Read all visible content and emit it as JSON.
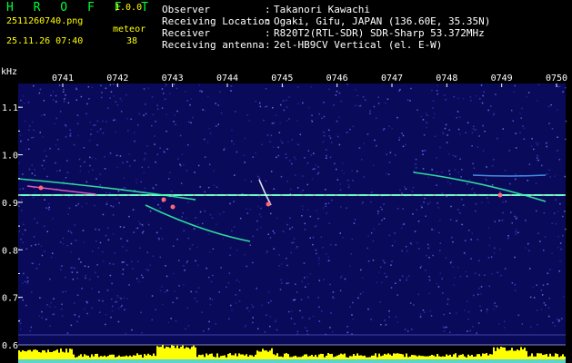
{
  "header": {
    "logo": "H R O F F T",
    "version": "1.0.0",
    "filename": "2511260740.png",
    "meteor_label": "meteor",
    "datetime": "25.11.26 07:40",
    "meteor_count": "38"
  },
  "info": [
    {
      "key": "Observer",
      "value": "Takanori Kawachi"
    },
    {
      "key": "Receiving Location",
      "value": "Ogaki, Gifu, JAPAN (136.60E, 35.35N)"
    },
    {
      "key": "Receiver",
      "value": "R820T2(RTL-SDR) SDR-Sharp 53.372MHz"
    },
    {
      "key": "Receiving antenna",
      "value": "2el-HB9CV Vertical (el. E-W)"
    }
  ],
  "chart_data": {
    "type": "heatmap",
    "x_ticks": [
      "0741",
      "0742",
      "0743",
      "0744",
      "0745",
      "0746",
      "0747",
      "0748",
      "0749",
      "0750"
    ],
    "y_unit": "kHz",
    "y_ticks": [
      "1.1",
      "1.0",
      "0.9",
      "0.8",
      "0.7",
      "0.6"
    ],
    "ylim": [
      0.6,
      1.15
    ],
    "carrier_khz": 0.915,
    "colors": {
      "background": "#0a0a5a",
      "axis": "#ffffff",
      "histogram": "#ffff00",
      "trail": "#33ffaa"
    }
  }
}
